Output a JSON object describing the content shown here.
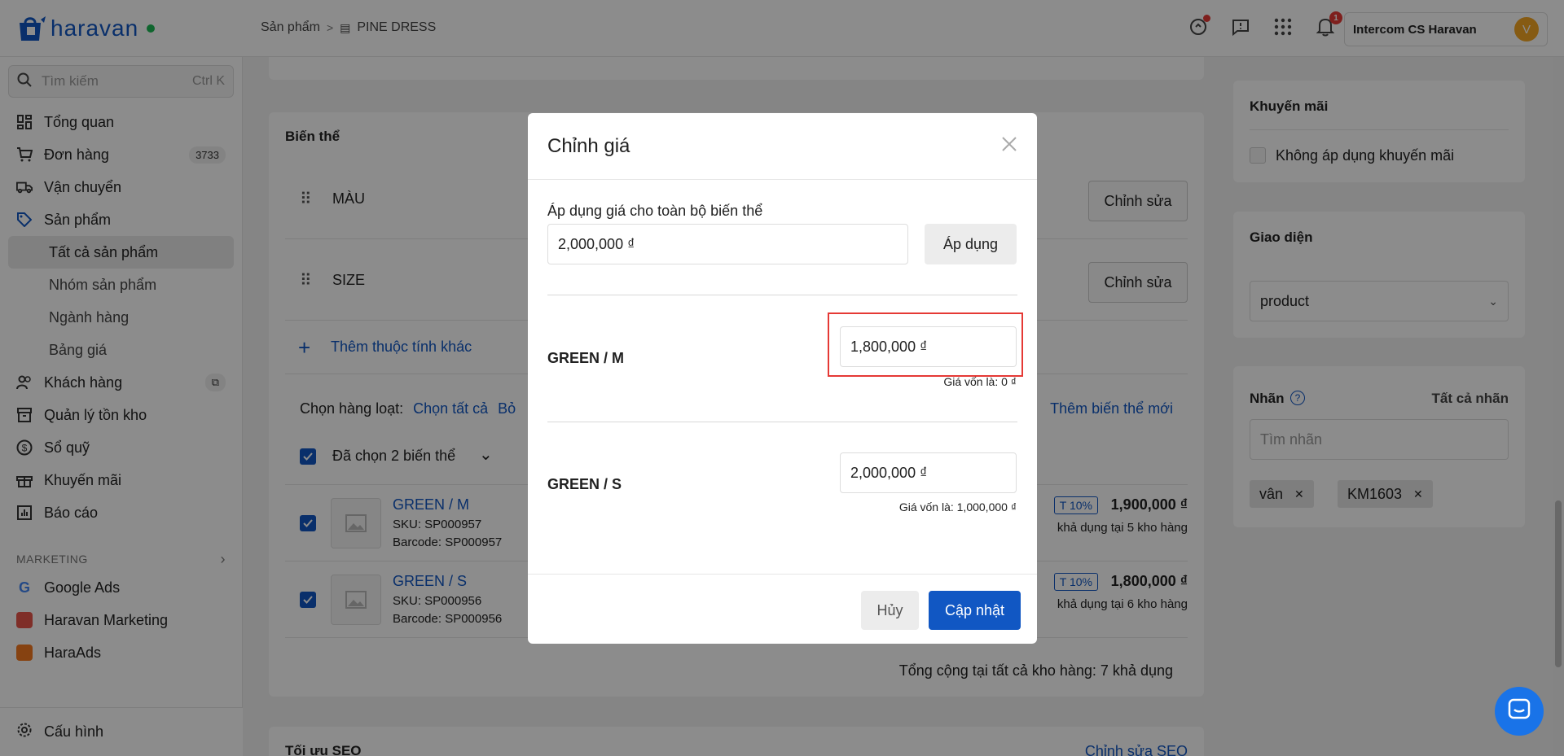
{
  "topbar": {
    "logo_text": "haravan",
    "breadcrumb": {
      "parent": "Sản phẩm",
      "current": "PINE DRESS"
    },
    "notification_count": "1",
    "account_name": "Intercom CS Haravan",
    "avatar_letter": "V"
  },
  "sidebar": {
    "search_placeholder": "Tìm kiếm",
    "search_shortcut": "Ctrl K",
    "items": {
      "overview": "Tổng quan",
      "orders": "Đơn hàng",
      "orders_count": "3733",
      "shipping": "Vận chuyển",
      "products": "Sản phẩm",
      "all_products": "Tất cả sản phẩm",
      "product_groups": "Nhóm sản phẩm",
      "categories": "Ngành hàng",
      "price_list": "Bảng giá",
      "customers": "Khách hàng",
      "inventory": "Quản lý tồn kho",
      "cashbook": "Sổ quỹ",
      "promotions": "Khuyến mãi",
      "reports": "Báo cáo"
    },
    "marketing_label": "MARKETING",
    "marketing": {
      "google_ads": "Google Ads",
      "haravan_marketing": "Haravan Marketing",
      "haraads": "HaraAds"
    },
    "settings": "Cấu hình"
  },
  "variants": {
    "title": "Biến thể",
    "options": [
      "MÀU",
      "SIZE"
    ],
    "edit_label": "Chỉnh sửa",
    "add_attribute": "Thêm thuộc tính khác",
    "bulk_label": "Chọn hàng loạt:",
    "select_all": "Chọn tất cả",
    "deselect": "Bỏ",
    "add_variant": "Thêm biến thể mới",
    "selected_label": "Đã chọn 2 biến thể",
    "rows": [
      {
        "name": "GREEN / M",
        "sku": "SKU: SP000957",
        "barcode": "Barcode: SP000957",
        "tag": "T 10%",
        "price": "1,900,000 ₫",
        "stock": "khả dụng tại 5 kho hàng"
      },
      {
        "name": "GREEN / S",
        "sku": "SKU: SP000956",
        "barcode": "Barcode: SP000956",
        "tag": "T 10%",
        "price": "1,800,000 ₫",
        "stock": "khả dụng tại 6 kho hàng"
      }
    ],
    "total": "Tổng cộng tại tất cả kho hàng: 7 khả dụng"
  },
  "seo": {
    "title": "Tối ưu SEO",
    "edit": "Chỉnh sửa SEO"
  },
  "promotion_card": {
    "title": "Khuyến mãi",
    "checkbox_label": "Không áp dụng khuyến mãi"
  },
  "theme_card": {
    "title": "Giao diện",
    "selected": "product"
  },
  "tags_card": {
    "title": "Nhãn",
    "all_tags": "Tất cả nhãn",
    "search_placeholder": "Tìm nhãn",
    "tags": [
      "vân",
      "KM1603"
    ]
  },
  "modal": {
    "title": "Chỉnh giá",
    "apply_all_label": "Áp dụng giá cho toàn bộ biến thể",
    "apply_all_value": "2,000,000 ₫",
    "apply_button": "Áp dụng",
    "variants": [
      {
        "name": "GREEN / M",
        "price": "1,800,000 ₫",
        "cost": "Giá vốn là: 0 ₫"
      },
      {
        "name": "GREEN / S",
        "price": "2,000,000 ₫",
        "cost": "Giá vốn là: 1,000,000 ₫"
      }
    ],
    "cancel": "Hủy",
    "update": "Cập nhật"
  },
  "colors": {
    "primary": "#1157c3",
    "highlight": "#e53935"
  }
}
